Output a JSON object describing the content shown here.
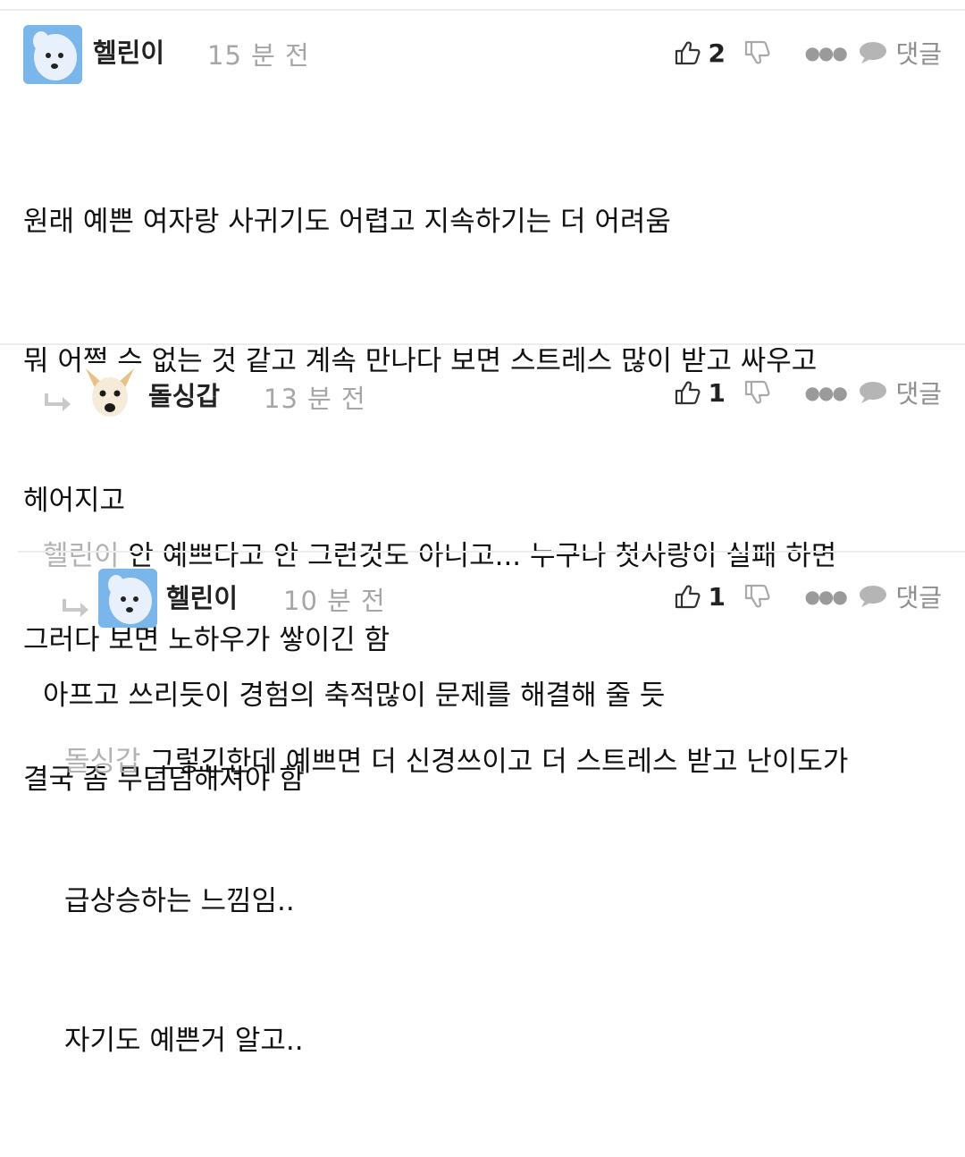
{
  "comments": [
    {
      "author": "헬린이",
      "time": "15 분 전",
      "likes": "2",
      "reply_label": "댓글",
      "mention": "",
      "lines": [
        "원래 예쁜 여자랑 사귀기도 어렵고 지속하기는 더 어려움",
        "뭐 어쩔 수 없는 것 같고 계속 만나다 보면 스트레스 많이 받고 싸우고",
        "헤어지고",
        "그러다 보면 노하우가 쌓이긴 함",
        "결국 좀 무덤덤해져야 함"
      ]
    },
    {
      "author": "돌싱갑",
      "time": "13 분 전",
      "likes": "1",
      "reply_label": "댓글",
      "mention": "헬린이",
      "lines": [
        " 안 예쁘다고 안 그런것도 아니고... 누구나 첫사랑이 실패 하면",
        "아프고 쓰리듯이 경험의 축적많이 문제를 해결해 줄 듯"
      ]
    },
    {
      "author": "헬린이",
      "time": "10 분 전",
      "likes": "1",
      "reply_label": "댓글",
      "mention": "돌싱갑",
      "lines": [
        " 그렇긴한데 예쁘면 더 신경쓰이고 더 스트레스 받고 난이도가",
        "급상승하는 느낌임..",
        "자기도 예쁜거 알고.."
      ]
    }
  ],
  "icons": {
    "like": "thumbs-up-icon",
    "dislike": "thumbs-down-icon",
    "more": "more-dots-icon",
    "reply": "speech-bubble-icon",
    "reply_arrow": "reply-arrow-icon"
  },
  "colors": {
    "mention": "#b2b2b2",
    "time": "#a6a6a6",
    "divider": "#ececec",
    "avatar_dog": "#7ab6ea"
  }
}
